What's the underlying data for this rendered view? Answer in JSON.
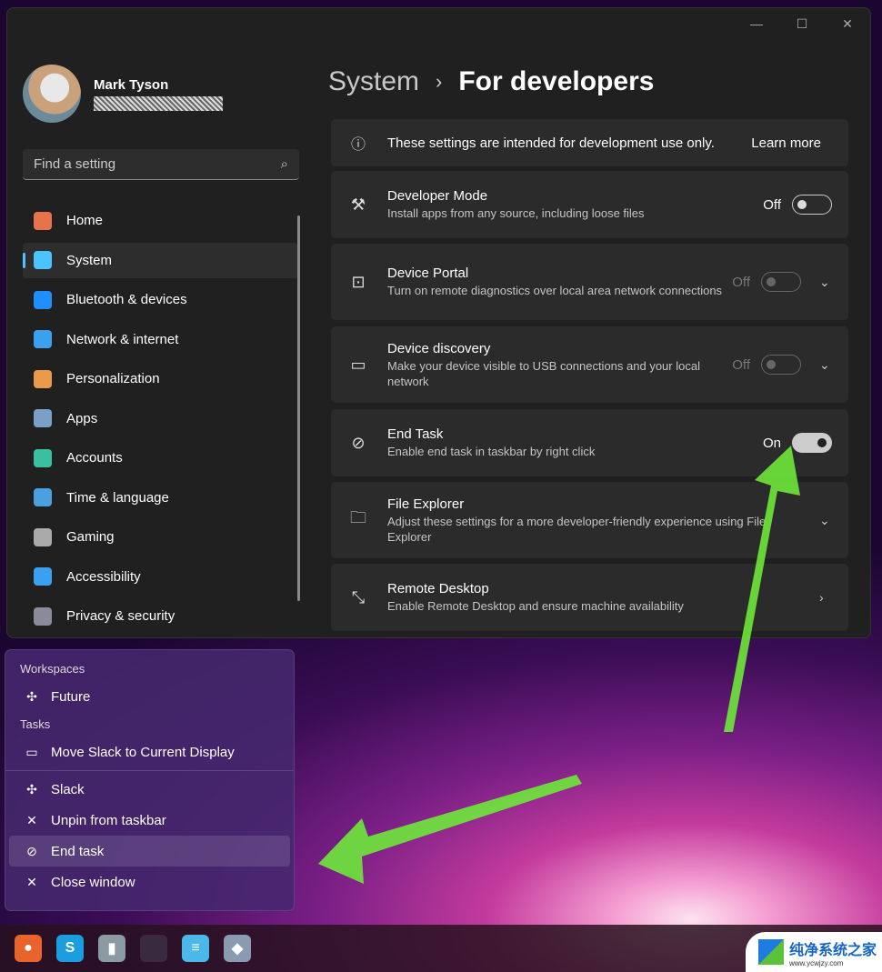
{
  "window": {
    "controls": [
      "—",
      "☐",
      "✕"
    ]
  },
  "profile": {
    "name": "Mark Tyson"
  },
  "search": {
    "placeholder": "Find a setting"
  },
  "nav": [
    {
      "label": "Home",
      "icon": "home-icon",
      "color": "#e8734a"
    },
    {
      "label": "System",
      "icon": "system-icon",
      "color": "#4cc2ff",
      "selected": true
    },
    {
      "label": "Bluetooth & devices",
      "icon": "bluetooth-icon",
      "color": "#1f8fff"
    },
    {
      "label": "Network & internet",
      "icon": "wifi-icon",
      "color": "#3aa0f0"
    },
    {
      "label": "Personalization",
      "icon": "brush-icon",
      "color": "#e89a4a"
    },
    {
      "label": "Apps",
      "icon": "apps-icon",
      "color": "#7aa0c8"
    },
    {
      "label": "Accounts",
      "icon": "accounts-icon",
      "color": "#3ac0a0"
    },
    {
      "label": "Time & language",
      "icon": "clock-globe-icon",
      "color": "#4aa0e0"
    },
    {
      "label": "Gaming",
      "icon": "gamepad-icon",
      "color": "#aaaaaa"
    },
    {
      "label": "Accessibility",
      "icon": "accessibility-icon",
      "color": "#3aa0f0"
    },
    {
      "label": "Privacy & security",
      "icon": "shield-icon",
      "color": "#8a8a9a"
    }
  ],
  "breadcrumb": {
    "parent": "System",
    "separator": "›",
    "current": "For developers"
  },
  "banner": {
    "text": "These settings are intended for development use only.",
    "link": "Learn more"
  },
  "settings": [
    {
      "title": "Developer Mode",
      "desc": "Install apps from any source, including loose files",
      "state": "Off",
      "on": false,
      "disabled": false,
      "chevron": "",
      "icon": "tools-icon",
      "glyph": "⚒"
    },
    {
      "title": "Device Portal",
      "desc": "Turn on remote diagnostics over local area network connections",
      "state": "Off",
      "on": false,
      "disabled": true,
      "chevron": "⌄",
      "icon": "pulse-icon",
      "glyph": "⊡"
    },
    {
      "title": "Device discovery",
      "desc": "Make your device visible to USB connections and your local network",
      "state": "Off",
      "on": false,
      "disabled": true,
      "chevron": "⌄",
      "icon": "device-discovery-icon",
      "glyph": "▭"
    },
    {
      "title": "End Task",
      "desc": "Enable end task in taskbar by right click",
      "state": "On",
      "on": true,
      "disabled": false,
      "chevron": "",
      "icon": "end-task-icon",
      "glyph": "⊘"
    },
    {
      "title": "File Explorer",
      "desc": "Adjust these settings for a more developer-friendly experience using File Explorer",
      "state": "",
      "chevron": "⌄",
      "icon": "folder-icon",
      "glyph": "🗀"
    },
    {
      "title": "Remote Desktop",
      "desc": "Enable Remote Desktop and ensure machine availability",
      "state": "",
      "chevron": "›",
      "icon": "remote-desktop-icon",
      "glyph": "⤡"
    }
  ],
  "jumplist": {
    "workspaces_label": "Workspaces",
    "workspaces": [
      {
        "label": "Future",
        "icon": "slack-icon",
        "glyph": "✣"
      }
    ],
    "tasks_label": "Tasks",
    "tasks": [
      {
        "label": "Move Slack to Current Display",
        "icon": "monitor-icon",
        "glyph": "▭"
      }
    ],
    "items": [
      {
        "label": "Slack",
        "icon": "slack-icon",
        "glyph": "✣"
      },
      {
        "label": "Unpin from taskbar",
        "icon": "unpin-icon",
        "glyph": "✕"
      },
      {
        "label": "End task",
        "icon": "end-task-icon",
        "glyph": "⊘",
        "highlighted": true
      },
      {
        "label": "Close window",
        "icon": "close-icon",
        "glyph": "✕"
      }
    ]
  },
  "taskbar": [
    {
      "name": "firefox",
      "color": "#e8642c",
      "glyph": "●"
    },
    {
      "name": "skype",
      "color": "#1a9ee0",
      "glyph": "S"
    },
    {
      "name": "file-app",
      "color": "#8a9aa0",
      "glyph": "▮"
    },
    {
      "name": "slack",
      "color": "#3a2a40",
      "glyph": ""
    },
    {
      "name": "notepad",
      "color": "#4ab8e8",
      "glyph": "≡"
    },
    {
      "name": "app",
      "color": "#8a9ab0",
      "glyph": "◆"
    }
  ],
  "watermark": {
    "title": "纯净系统之家",
    "url": "www.ycwjzy.com"
  },
  "annotation_color": "#6ee83a"
}
